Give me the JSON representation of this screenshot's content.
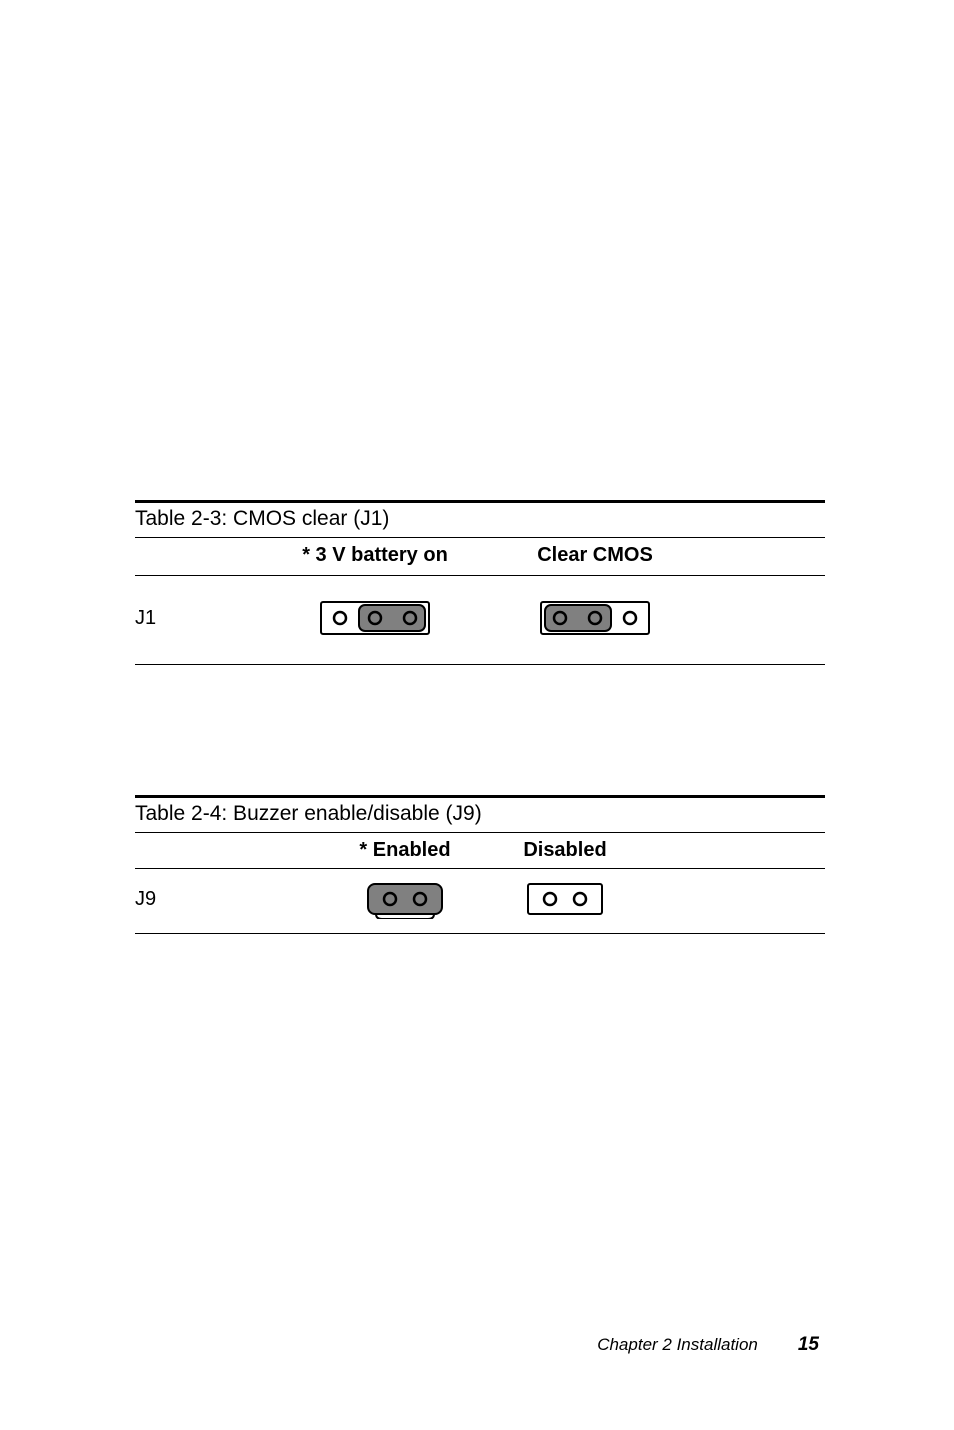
{
  "table1": {
    "title": "Table 2-3: CMOS clear (J1)",
    "col1_header": "",
    "col2_header": "* 3 V battery on",
    "col3_header": "Clear CMOS",
    "row_label": "J1",
    "jumper_state_col2": "pins-2-3-shorted",
    "jumper_state_col3": "pins-1-2-shorted"
  },
  "table2": {
    "title": "Table 2-4: Buzzer enable/disable (J9)",
    "col1_header": "",
    "col2_header": "* Enabled",
    "col3_header": "Disabled",
    "row_label": "J9",
    "jumper_state_col2": "pins-1-2-shorted",
    "jumper_state_col3": "open"
  },
  "footer": {
    "chapter": "Chapter 2   Installation",
    "page": "15"
  }
}
